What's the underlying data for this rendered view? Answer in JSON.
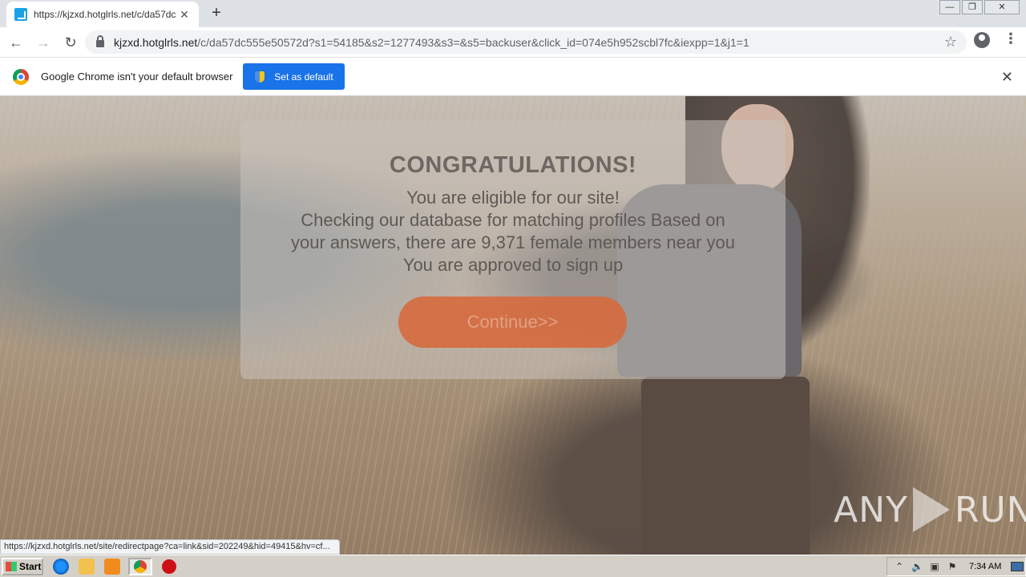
{
  "browser": {
    "tab": {
      "title": "https://kjzxd.hotglrls.net/c/da57dc5",
      "close": "✕"
    },
    "new_tab": "+",
    "window": {
      "minimize": "—",
      "maximize": "❐",
      "close": "✕"
    },
    "nav": {
      "back": "←",
      "forward": "→",
      "reload": "↻"
    },
    "url": {
      "host": "kjzxd.hotglrls.net",
      "path": "/c/da57dc555e50572d?s1=54185&s2=1277493&s3=&s5=backuser&click_id=074e5h952scbl7fc&iexpp=1&j1=1"
    },
    "star": "☆",
    "menu": "⋮"
  },
  "infobar": {
    "message": "Google Chrome isn't your default browser",
    "button": "Set as default",
    "close": "✕"
  },
  "modal": {
    "title": "CONGRATULATIONS!",
    "lines": [
      "You are eligible for our site!",
      "Checking our database for matching profiles Based on",
      "your answers, there are 9,371 female members near you",
      "You are approved to sign up"
    ],
    "button": "Continue>>"
  },
  "watermark": {
    "left": "ANY",
    "right": "RUN"
  },
  "status_url": "https://kjzxd.hotglrls.net/site/redirectpage?ca=link&sid=202249&hid=49415&hv=cf...",
  "taskbar": {
    "start": "Start",
    "clock": "7:34 AM"
  },
  "colors": {
    "accent": "#1a73e8",
    "cta": "#d66a3e"
  }
}
